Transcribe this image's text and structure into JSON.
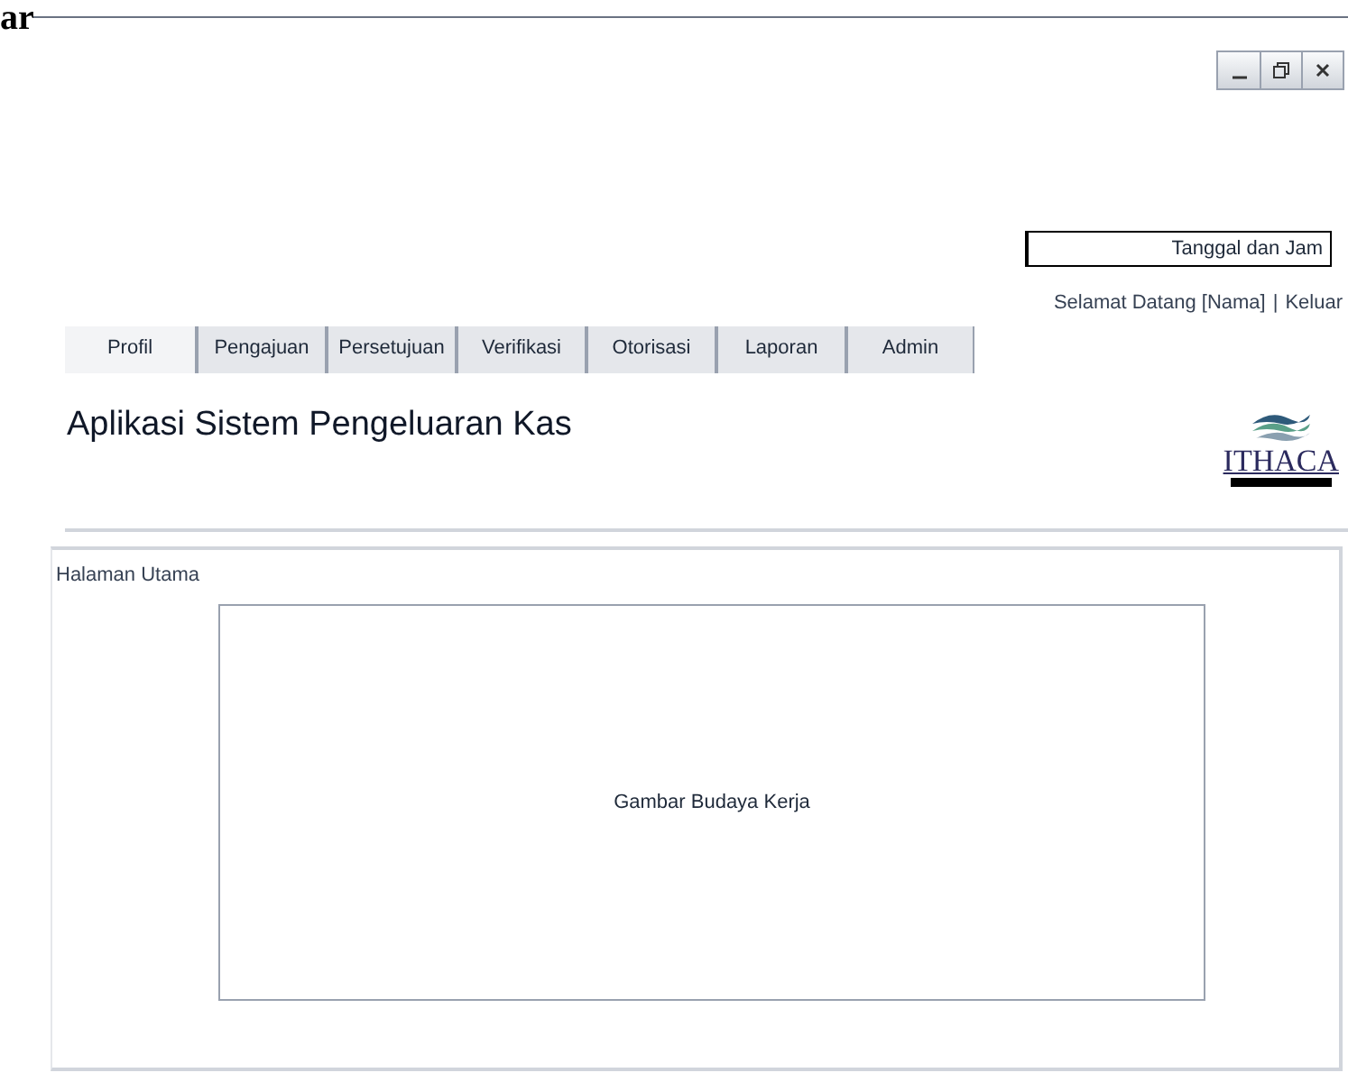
{
  "heading_fragment": "ar",
  "window_controls": [
    {
      "kind": "minimize"
    },
    {
      "kind": "restore"
    },
    {
      "kind": "close"
    }
  ],
  "datetime_field": {
    "value": "Tanggal dan Jam"
  },
  "user_bar": {
    "greeting": "Selamat Datang [Nama]",
    "separator": "|",
    "logout": "Keluar"
  },
  "tabs": [
    {
      "label": "Profil",
      "selected": true
    },
    {
      "label": "Pengajuan",
      "selected": false
    },
    {
      "label": "Persetujuan",
      "selected": false
    },
    {
      "label": "Verifikasi",
      "selected": false
    },
    {
      "label": "Otorisasi",
      "selected": false
    },
    {
      "label": "Laporan",
      "selected": false
    },
    {
      "label": "Admin",
      "selected": false
    }
  ],
  "header": {
    "title": "Aplikasi Sistem Pengeluaran Kas",
    "logo_text": "ITHACA"
  },
  "main": {
    "title": "Halaman Utama",
    "placeholder_box": "Gambar Budaya Kerja"
  }
}
